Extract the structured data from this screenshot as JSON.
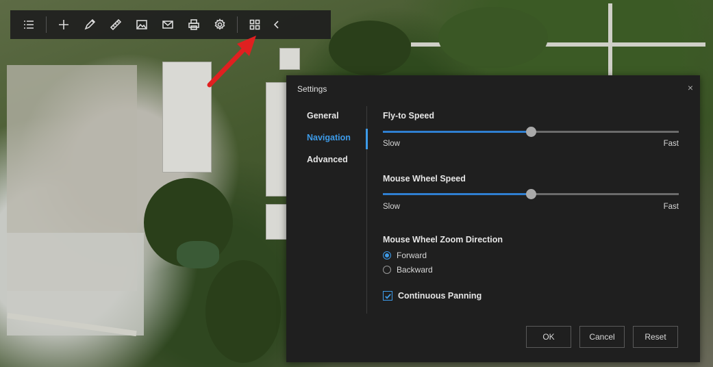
{
  "toolbar": {
    "buttons": [
      "list-icon",
      "plus-icon",
      "pencil-icon",
      "ruler-icon",
      "image-icon",
      "mail-icon",
      "print-icon",
      "gear-icon",
      "grid-icon",
      "chevron-left-icon"
    ]
  },
  "dialog": {
    "title": "Settings",
    "close_glyph": "×",
    "nav": {
      "items": [
        {
          "label": "General",
          "active": false
        },
        {
          "label": "Navigation",
          "active": true
        },
        {
          "label": "Advanced",
          "active": false
        }
      ]
    },
    "flyto": {
      "label": "Fly-to Speed",
      "value_percent": 50,
      "min_label": "Slow",
      "max_label": "Fast"
    },
    "wheel": {
      "label": "Mouse Wheel Speed",
      "value_percent": 50,
      "min_label": "Slow",
      "max_label": "Fast"
    },
    "zoom_direction": {
      "label": "Mouse Wheel Zoom Direction",
      "options": [
        {
          "label": "Forward",
          "checked": true
        },
        {
          "label": "Backward",
          "checked": false
        }
      ]
    },
    "continuous_panning": {
      "label": "Continuous Panning",
      "checked": true
    },
    "buttons": {
      "ok": "OK",
      "cancel": "Cancel",
      "reset": "Reset"
    }
  },
  "colors": {
    "accent": "#3d9be9",
    "dialog_bg": "#1f1f1f",
    "arrow": "#e02020"
  }
}
